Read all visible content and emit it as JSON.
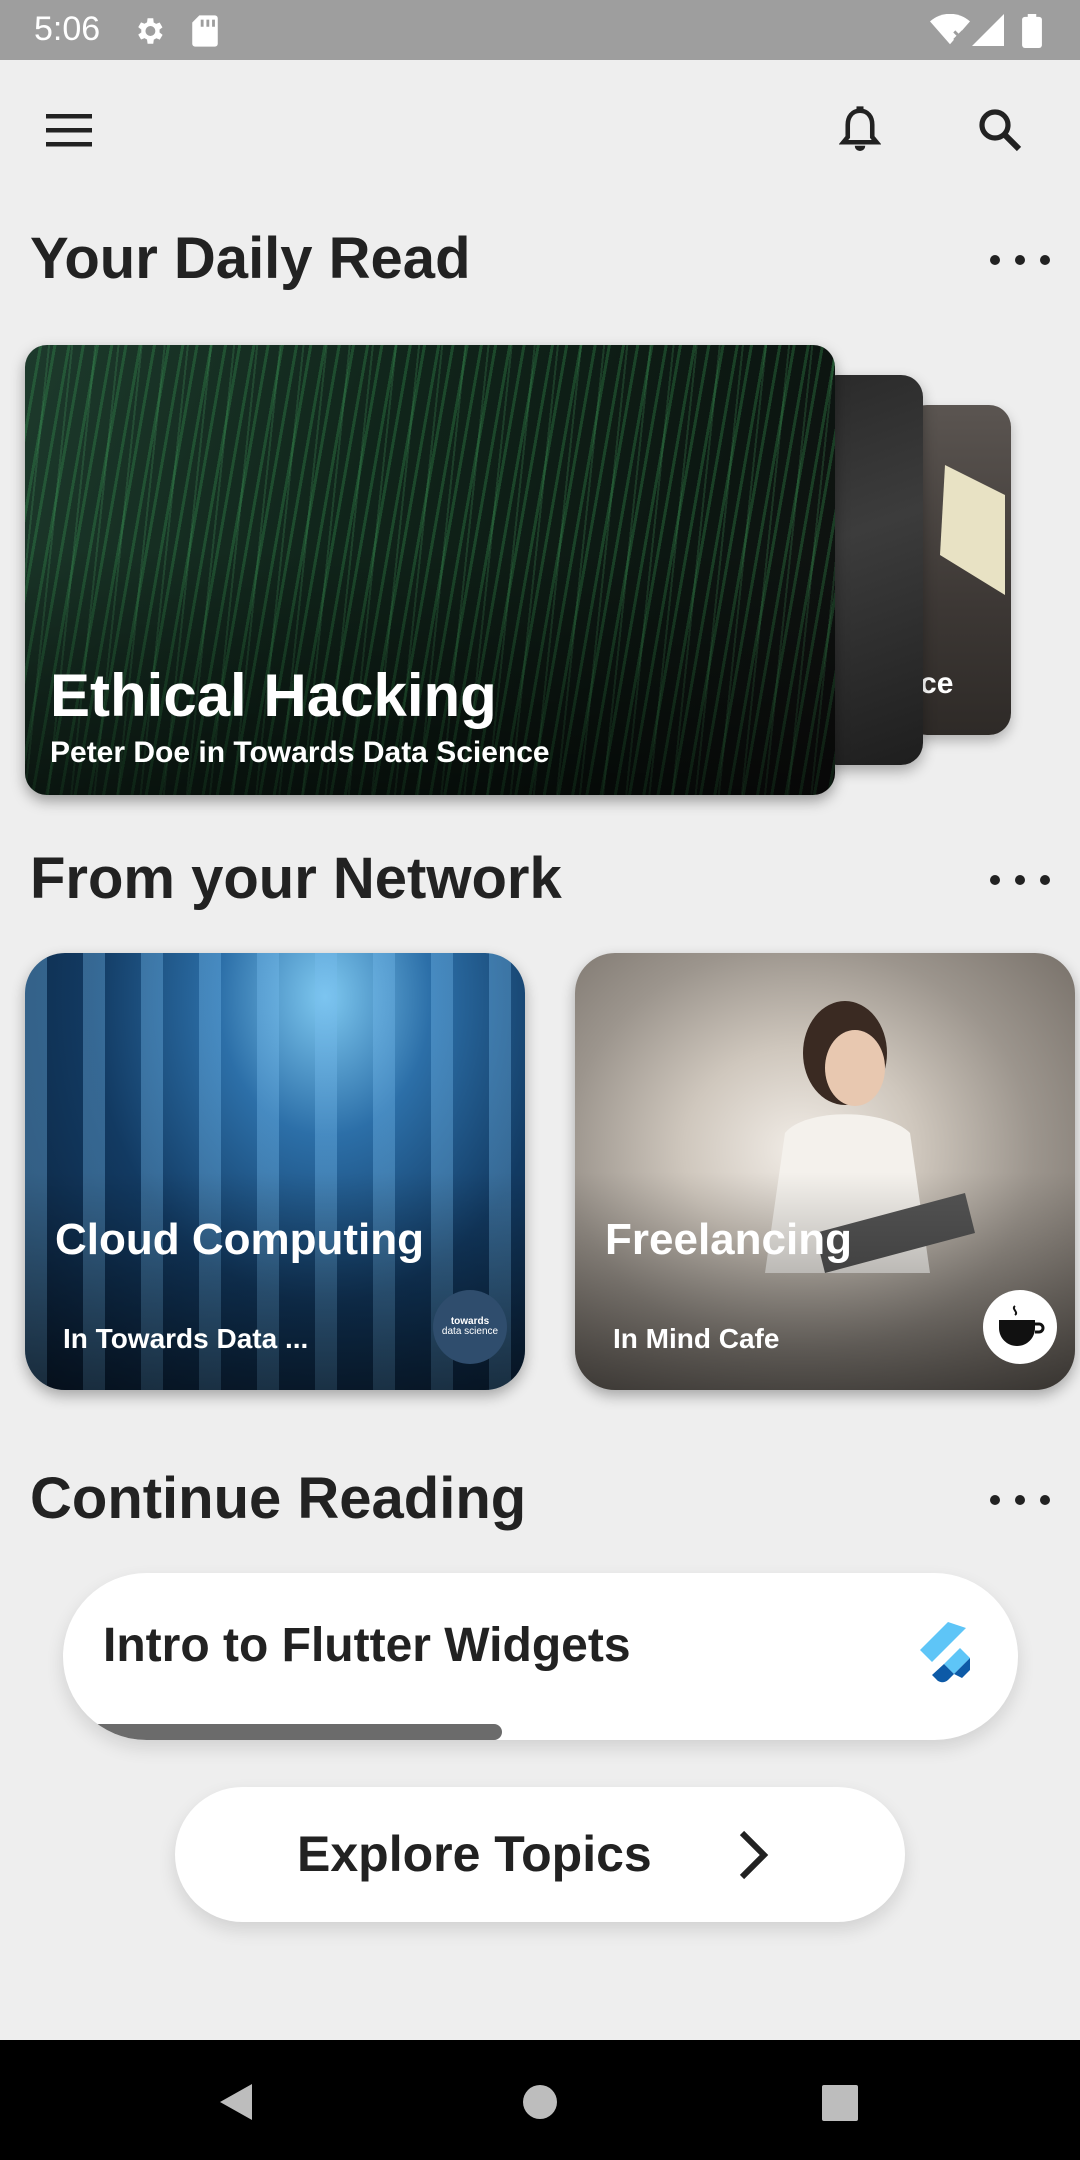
{
  "status_bar": {
    "time": "5:06",
    "icons": [
      "settings-icon",
      "sd-card-icon",
      "wifi-icon",
      "signal-icon",
      "battery-icon"
    ]
  },
  "app_bar": {
    "icons": [
      "menu-icon",
      "bell-icon",
      "search-icon"
    ]
  },
  "daily_read": {
    "title": "Your Daily Read",
    "cards": [
      {
        "title": "Ethical Hacking",
        "subtitle": "Peter Doe in Towards Data Science"
      },
      {
        "peek_text": "ence"
      }
    ]
  },
  "network": {
    "title": "From your Network",
    "cards": [
      {
        "title": "Cloud Computing",
        "subtitle": "In Towards Data ...",
        "logo_text_1": "towards",
        "logo_text_2": "data science"
      },
      {
        "title": "Freelancing",
        "subtitle": "In Mind Cafe"
      }
    ]
  },
  "continue_reading": {
    "title": "Continue Reading",
    "item_title": "Intro to Flutter Widgets",
    "progress": 0.46
  },
  "explore": {
    "label": "Explore Topics"
  },
  "colors": {
    "background": "#eeeeee",
    "status_bar": "#9e9e9e",
    "text": "#222222",
    "progress": "#6b6b6b",
    "flutter_light": "#5ec5f7",
    "flutter_dark": "#0d5aa7"
  }
}
